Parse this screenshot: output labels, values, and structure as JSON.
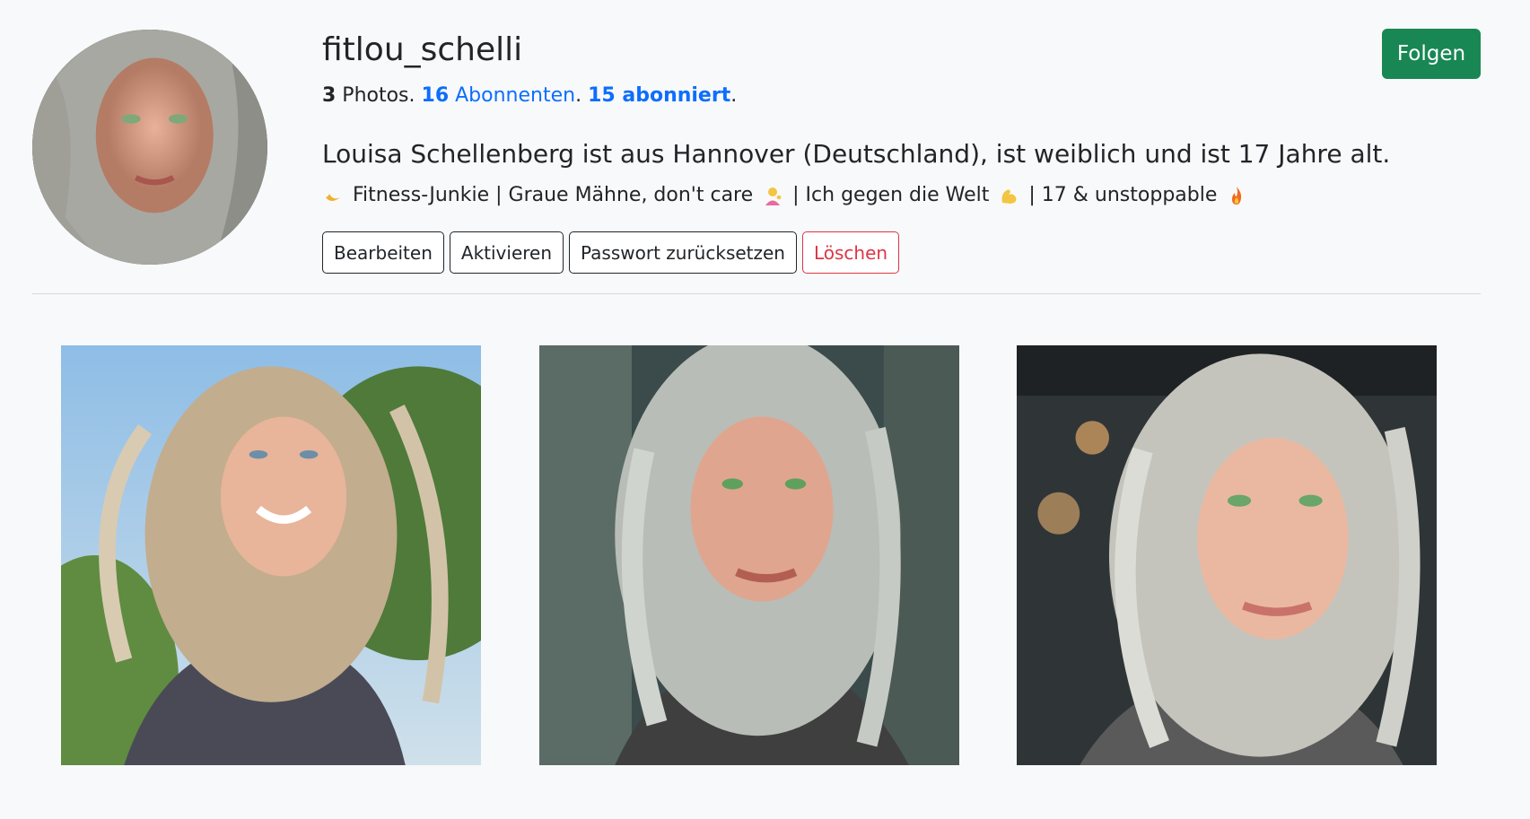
{
  "profile": {
    "username": "fitlou_schelli",
    "follow_label": "Folgen",
    "stats": {
      "photos_count": "3",
      "photos_label": " Photos. ",
      "followers_count": "16",
      "followers_label": " Abonnenten",
      "sep": ". ",
      "following_count": "15",
      "following_label": " abonniert",
      "end": "."
    },
    "bio": "Louisa Schellenberg ist aus Hannover (Deutschland), ist weiblich und ist 17 Jahre alt.",
    "tagline": {
      "part1": "Fitness-Junkie | Graue Mähne, don't care",
      "part2": "| Ich gegen die Welt",
      "part3": "| 17 & unstoppable"
    },
    "icons": [
      "crescent-moon-icon",
      "person-tipping-hand-icon",
      "flexed-biceps-icon",
      "fire-icon"
    ]
  },
  "actions": {
    "edit": "Bearbeiten",
    "activate": "Aktivieren",
    "reset_password": "Passwort zurücksetzen",
    "delete": "Löschen"
  },
  "colors": {
    "follow": "#198754",
    "link": "#0d6efd",
    "danger": "#dc3545",
    "background": "#f8f9fa"
  }
}
